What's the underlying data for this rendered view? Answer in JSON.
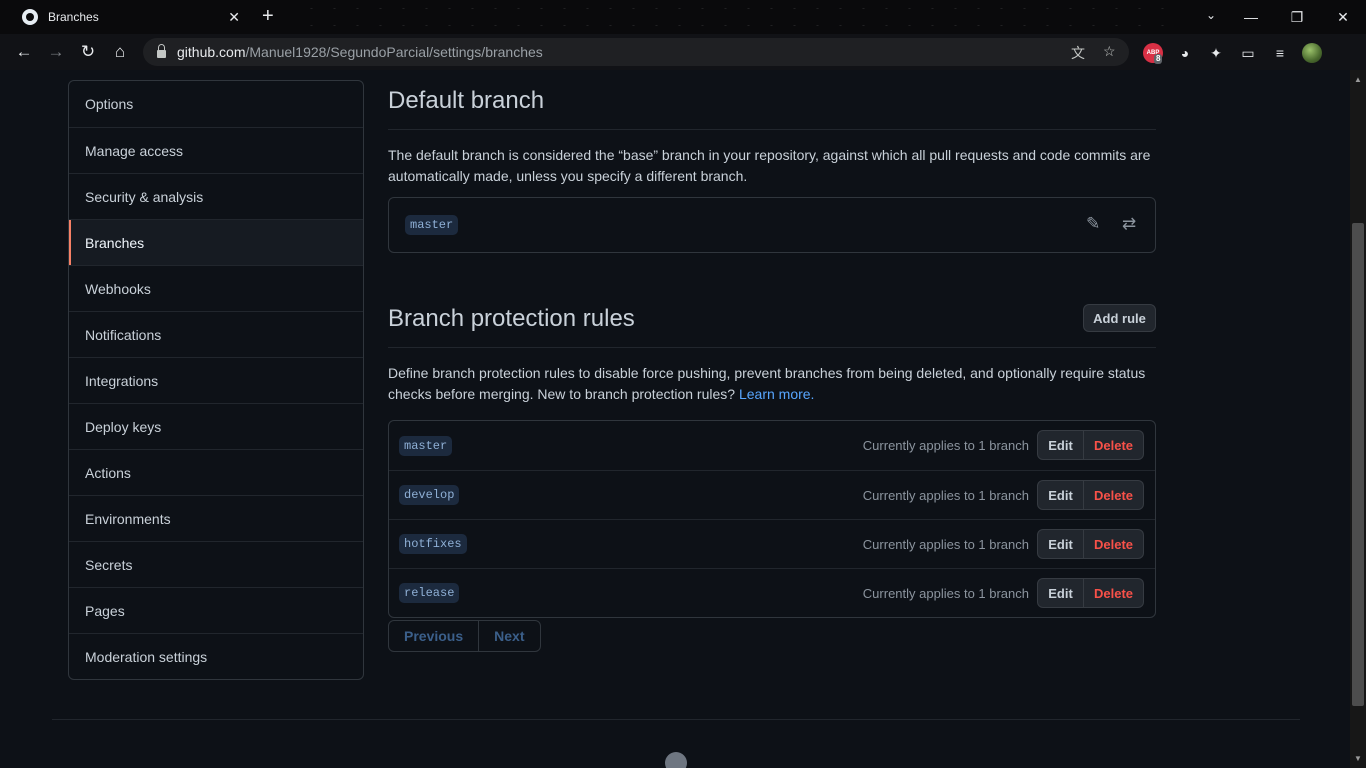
{
  "browser": {
    "tab_title": "Branches",
    "tab_close": "✕",
    "new_tab": "+",
    "url_host": "github.com",
    "url_path": "/Manuel1928/SegundoParcial/settings/branches",
    "extension_badge": "8",
    "extension_label": "ABP"
  },
  "sidebar": {
    "items": [
      {
        "label": "Options"
      },
      {
        "label": "Manage access"
      },
      {
        "label": "Security & analysis"
      },
      {
        "label": "Branches",
        "active": true
      },
      {
        "label": "Webhooks"
      },
      {
        "label": "Notifications"
      },
      {
        "label": "Integrations"
      },
      {
        "label": "Deploy keys"
      },
      {
        "label": "Actions"
      },
      {
        "label": "Environments"
      },
      {
        "label": "Secrets"
      },
      {
        "label": "Pages"
      },
      {
        "label": "Moderation settings"
      }
    ]
  },
  "default_branch": {
    "title": "Default branch",
    "description": "The default branch is considered the “base” branch in your repository, against which all pull requests and code commits are automatically made, unless you specify a different branch.",
    "branch": "master",
    "edit_icon": "pencil-icon",
    "switch_icon": "arrow-switch-icon"
  },
  "protection": {
    "title": "Branch protection rules",
    "add_rule_label": "Add rule",
    "description": "Define branch protection rules to disable force pushing, prevent branches from being deleted, and optionally require status checks before merging. New to branch protection rules?",
    "learn_more": "Learn more.",
    "rules": [
      {
        "branch": "master",
        "applies": "Currently applies to 1 branch",
        "edit": "Edit",
        "delete": "Delete"
      },
      {
        "branch": "develop",
        "applies": "Currently applies to 1 branch",
        "edit": "Edit",
        "delete": "Delete"
      },
      {
        "branch": "hotfixes",
        "applies": "Currently applies to 1 branch",
        "edit": "Edit",
        "delete": "Delete"
      },
      {
        "branch": "release",
        "applies": "Currently applies to 1 branch",
        "edit": "Edit",
        "delete": "Delete"
      }
    ],
    "pagination": {
      "previous": "Previous",
      "next": "Next"
    }
  },
  "colors": {
    "background": "#0d1117",
    "active_indicator": "#f78166",
    "link": "#58a6ff",
    "danger": "#f85149"
  }
}
